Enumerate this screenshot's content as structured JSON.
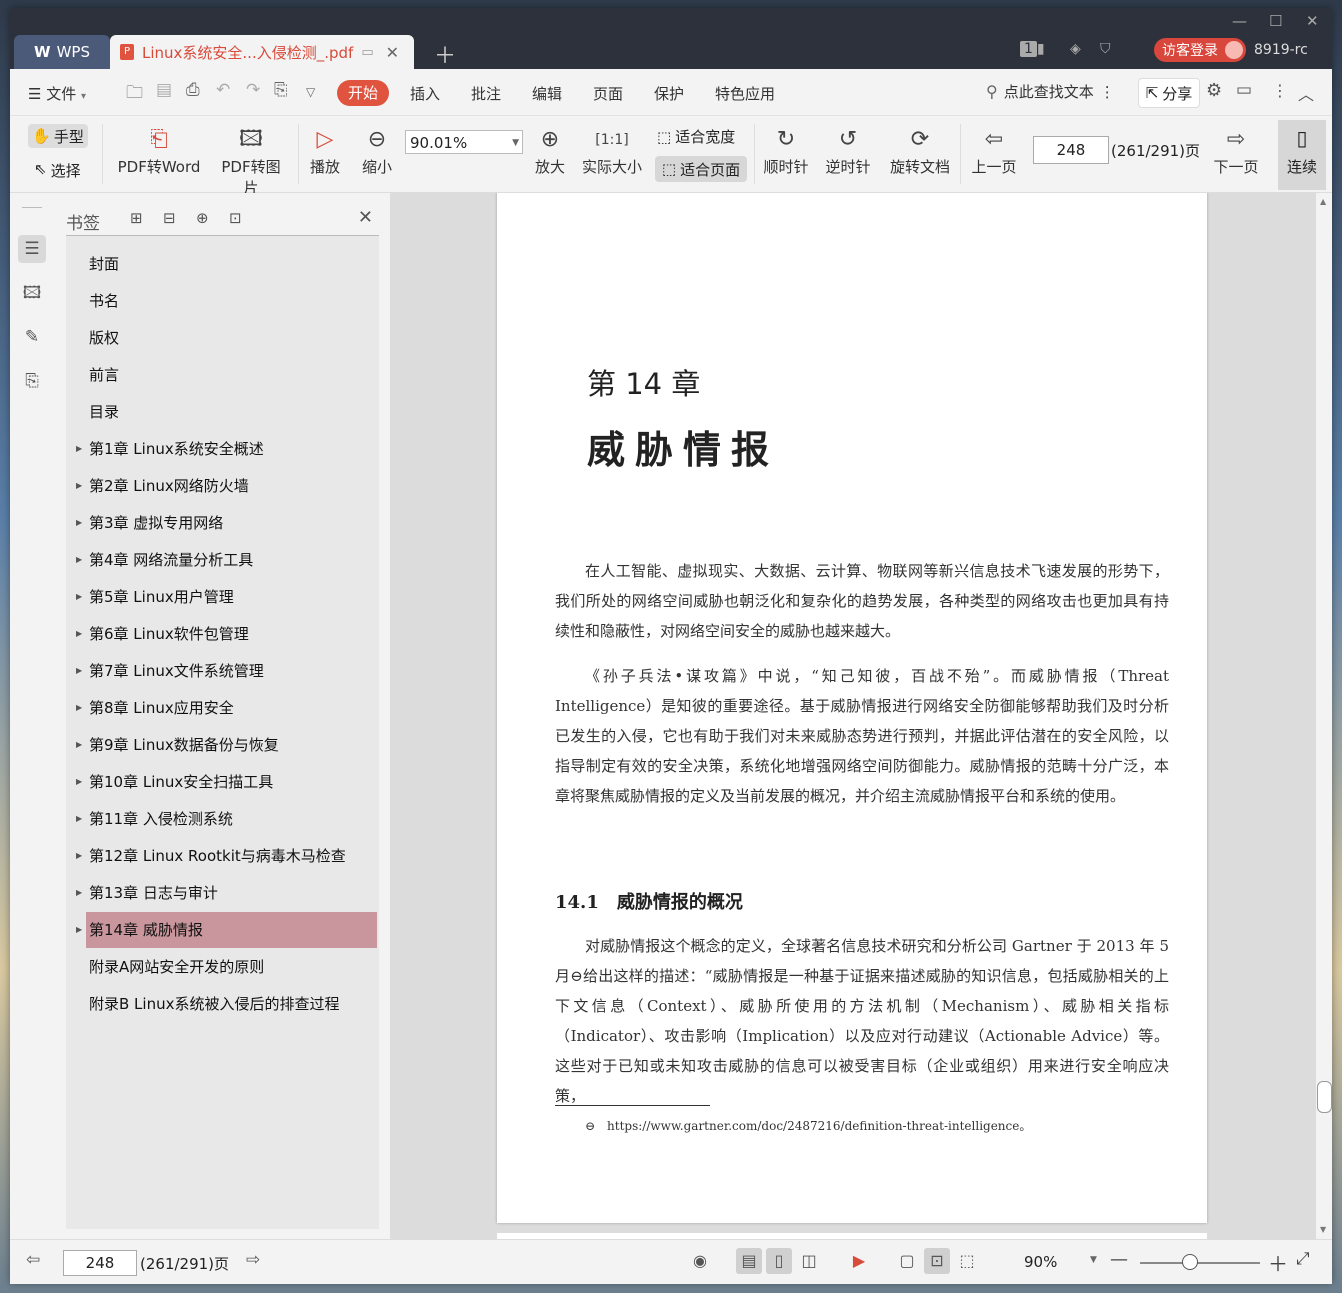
{
  "titlebar": {
    "app_tab": "WPS",
    "doc_tab": "Linux系统安全...入侵检测_.pdf",
    "visitor_login": "访客登录",
    "user_id": "8919-rc",
    "badge": "1"
  },
  "menu": {
    "file": "文件",
    "start": "开始",
    "insert": "插入",
    "comment": "批注",
    "edit": "编辑",
    "page": "页面",
    "protect": "保护",
    "special": "特色应用",
    "find": "点此查找文本",
    "share": "分享"
  },
  "toolbar": {
    "hand": "手型",
    "select": "选择",
    "pdf_to_word": "PDF转Word",
    "pdf_to_image": "PDF转图片",
    "play": "播放",
    "zoom_out": "缩小",
    "zoom_value": "90.01%",
    "zoom_in": "放大",
    "actual_size": "实际大小",
    "fit_width": "适合宽度",
    "fit_page": "适合页面",
    "rotate_cw": "顺时针",
    "rotate_ccw": "逆时针",
    "rotate_doc": "旋转文档",
    "prev_page": "上一页",
    "page_number": "248",
    "page_total": "(261/291)页",
    "next_page": "下一页",
    "continuous": "连续"
  },
  "bookmarks": {
    "title": "书签",
    "items": [
      {
        "label": "封面",
        "expandable": false
      },
      {
        "label": "书名",
        "expandable": false
      },
      {
        "label": "版权",
        "expandable": false
      },
      {
        "label": "前言",
        "expandable": false
      },
      {
        "label": "目录",
        "expandable": false
      },
      {
        "label": "第1章 Linux系统安全概述",
        "expandable": true
      },
      {
        "label": "第2章 Linux网络防火墙",
        "expandable": true
      },
      {
        "label": "第3章 虚拟专用网络",
        "expandable": true
      },
      {
        "label": "第4章 网络流量分析工具",
        "expandable": true
      },
      {
        "label": "第5章 Linux用户管理",
        "expandable": true
      },
      {
        "label": "第6章 Linux软件包管理",
        "expandable": true
      },
      {
        "label": "第7章 Linux文件系统管理",
        "expandable": true
      },
      {
        "label": "第8章 Linux应用安全",
        "expandable": true
      },
      {
        "label": "第9章 Linux数据备份与恢复",
        "expandable": true
      },
      {
        "label": "第10章 Linux安全扫描工具",
        "expandable": true
      },
      {
        "label": "第11章 入侵检测系统",
        "expandable": true
      },
      {
        "label": "第12章 Linux Rootkit与病毒木马检查",
        "expandable": true
      },
      {
        "label": "第13章 日志与审计",
        "expandable": true
      },
      {
        "label": "第14章 威胁情报",
        "expandable": true,
        "active": true
      },
      {
        "label": "附录A网站安全开发的原则",
        "expandable": false
      },
      {
        "label": "附录B Linux系统被入侵后的排查过程",
        "expandable": false
      }
    ]
  },
  "document": {
    "chapter_number": "第 14 章",
    "chapter_title": "威胁情报",
    "para1": "在人工智能、虚拟现实、大数据、云计算、物联网等新兴信息技术飞速发展的形势下，我们所处的网络空间威胁也朝泛化和复杂化的趋势发展，各种类型的网络攻击也更加具有持续性和隐蔽性，对网络空间安全的威胁也越来越大。",
    "para2": "《孙子兵法•谋攻篇》中说，“知己知彼，百战不殆”。而威胁情报（Threat Intelligence）是知彼的重要途径。基于威胁情报进行网络安全防御能够帮助我们及时分析已发生的入侵，它也有助于我们对未来威胁态势进行预判，并据此评估潜在的安全风险，以指导制定有效的安全决策，系统化地增强网络空间防御能力。威胁情报的范畴十分广泛，本章将聚焦威胁情报的定义及当前发展的概况，并介绍主流威胁情报平台和系统的使用。",
    "section_heading": "14.1　威胁情报的概况",
    "para3": "对威胁情报这个概念的定义，全球著名信息技术研究和分析公司 Gartner 于 2013 年 5 月⊖给出这样的描述：“威胁情报是一种基于证据来描述威胁的知识信息，包括威胁相关的上下文信息（Context）、威胁所使用的方法机制（Mechanism）、威胁相关指标（Indicator）、攻击影响（Implication）以及应对行动建议（Actionable Advice）等。这些对于已知或未知攻击威胁的信息可以被受害目标（企业或组织）用来进行安全响应决策，",
    "footnote": "⊖　https://www.gartner.com/doc/2487216/definition-threat-intelligence。"
  },
  "statusbar": {
    "page_number": "248",
    "page_total": "(261/291)页",
    "zoom": "90%"
  }
}
